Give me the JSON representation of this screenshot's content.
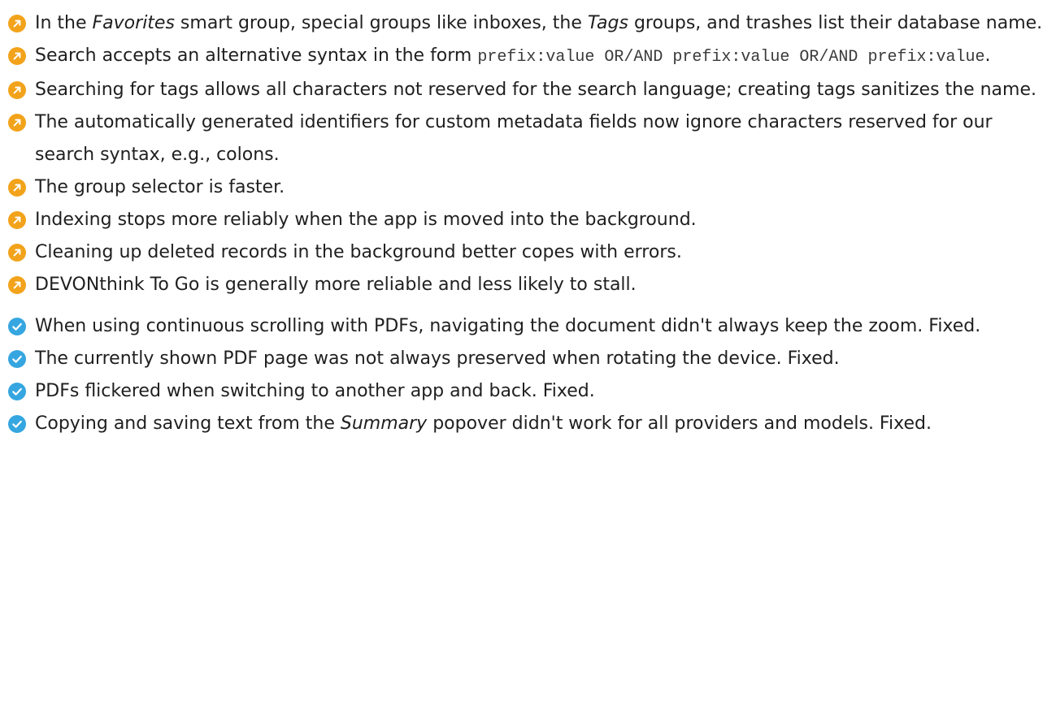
{
  "colors": {
    "improvement": "#F2A31B",
    "fix": "#35A6E0"
  },
  "items": [
    {
      "kind": "improvement",
      "icon": "arrow-up-right-icon",
      "segments": [
        {
          "t": "In the ",
          "s": ""
        },
        {
          "t": "Favorites",
          "s": "em"
        },
        {
          "t": " smart group, special groups like inboxes, the ",
          "s": ""
        },
        {
          "t": "Tags",
          "s": "em"
        },
        {
          "t": " groups, and trashes list their database name.",
          "s": ""
        }
      ]
    },
    {
      "kind": "improvement",
      "icon": "arrow-up-right-icon",
      "segments": [
        {
          "t": "Search accepts an alternative syntax in the form ",
          "s": ""
        },
        {
          "t": "prefix:value OR/AND prefix:value OR/AND prefix:value",
          "s": "code"
        },
        {
          "t": ".",
          "s": ""
        }
      ]
    },
    {
      "kind": "improvement",
      "icon": "arrow-up-right-icon",
      "segments": [
        {
          "t": "Searching for tags allows all characters not reserved for the search language; creating tags sanitizes the name.",
          "s": ""
        }
      ]
    },
    {
      "kind": "improvement",
      "icon": "arrow-up-right-icon",
      "segments": [
        {
          "t": "The automatically generated identifiers for custom metadata fields now ignore characters reserved for our search syntax, e.g., colons.",
          "s": ""
        }
      ]
    },
    {
      "kind": "improvement",
      "icon": "arrow-up-right-icon",
      "segments": [
        {
          "t": "The group selector is faster.",
          "s": ""
        }
      ]
    },
    {
      "kind": "improvement",
      "icon": "arrow-up-right-icon",
      "segments": [
        {
          "t": "Indexing stops more reliably when the app is moved into the background.",
          "s": ""
        }
      ]
    },
    {
      "kind": "improvement",
      "icon": "arrow-up-right-icon",
      "segments": [
        {
          "t": "Cleaning up deleted records in the background better copes with errors.",
          "s": ""
        }
      ]
    },
    {
      "kind": "improvement",
      "icon": "arrow-up-right-icon",
      "segments": [
        {
          "t": "DEVONthink To Go is generally more reliable and less likely to stall.",
          "s": ""
        }
      ]
    },
    {
      "kind": "fix",
      "icon": "checkmark-icon",
      "gap": true,
      "segments": [
        {
          "t": "When using continuous scrolling with PDFs, navigating the document didn't always keep the zoom. Fixed.",
          "s": ""
        }
      ]
    },
    {
      "kind": "fix",
      "icon": "checkmark-icon",
      "segments": [
        {
          "t": "The currently shown PDF page was not always preserved when rotating the device. Fixed.",
          "s": ""
        }
      ]
    },
    {
      "kind": "fix",
      "icon": "checkmark-icon",
      "segments": [
        {
          "t": "PDFs flickered when switching to another app and back. Fixed.",
          "s": ""
        }
      ]
    },
    {
      "kind": "fix",
      "icon": "checkmark-icon",
      "segments": [
        {
          "t": "Copying and saving text from the ",
          "s": ""
        },
        {
          "t": "Summary",
          "s": "em"
        },
        {
          "t": " popover didn't work for all providers and models. Fixed.",
          "s": ""
        }
      ]
    }
  ]
}
